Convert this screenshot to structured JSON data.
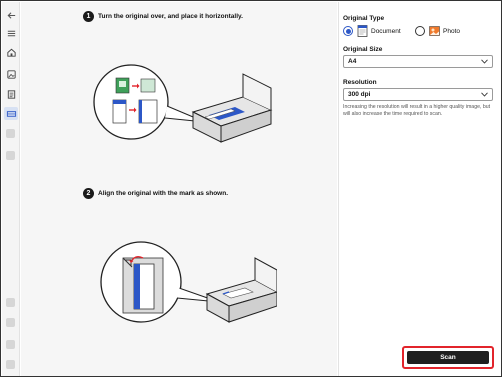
{
  "steps": [
    {
      "number": "1",
      "text": "Turn the original over, and place it horizontally."
    },
    {
      "number": "2",
      "text": "Align the original with the mark as shown."
    }
  ],
  "sidebar": {
    "items": [
      {
        "icon": "back-arrow-icon"
      },
      {
        "icon": "menu-icon"
      },
      {
        "icon": "home-icon"
      },
      {
        "icon": "photo-print-icon"
      },
      {
        "icon": "document-icon"
      },
      {
        "icon": "scan-icon",
        "active": true
      }
    ]
  },
  "settings": {
    "original_type": {
      "label": "Original Type",
      "options": [
        {
          "label": "Document",
          "icon": "document-icon",
          "selected": true
        },
        {
          "label": "Photo",
          "icon": "photo-icon",
          "selected": false
        }
      ]
    },
    "original_size": {
      "label": "Original Size",
      "value": "A4"
    },
    "resolution": {
      "label": "Resolution",
      "value": "300 dpi",
      "note": "Increasing the resolution will result in a higher quality image, but will also increase the time required to scan."
    }
  },
  "actions": {
    "scan_label": "Scan"
  },
  "colors": {
    "accent": "#2c57c7",
    "highlight": "#e2242b",
    "button_bg": "#1f1f1f"
  }
}
